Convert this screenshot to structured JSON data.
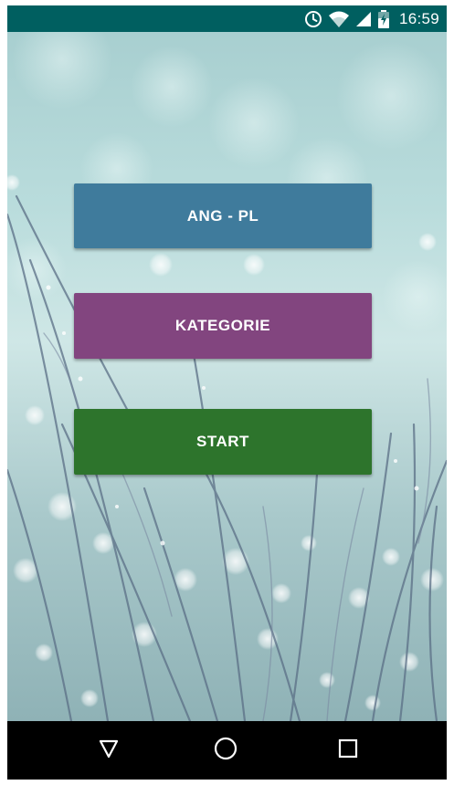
{
  "status_bar": {
    "time": "16:59",
    "icons": [
      "alarm-icon",
      "wifi-icon",
      "signal-icon",
      "battery-charging-icon"
    ],
    "background_color": "#005f60"
  },
  "menu": {
    "buttons": [
      {
        "label": "ANG - PL",
        "color": "#3f7b9c"
      },
      {
        "label": "KATEGORIE",
        "color": "#82457f"
      },
      {
        "label": "START",
        "color": "#2d742c"
      }
    ]
  },
  "nav_bar": {
    "icons": [
      "back-icon",
      "home-icon",
      "recent-apps-icon"
    ]
  }
}
